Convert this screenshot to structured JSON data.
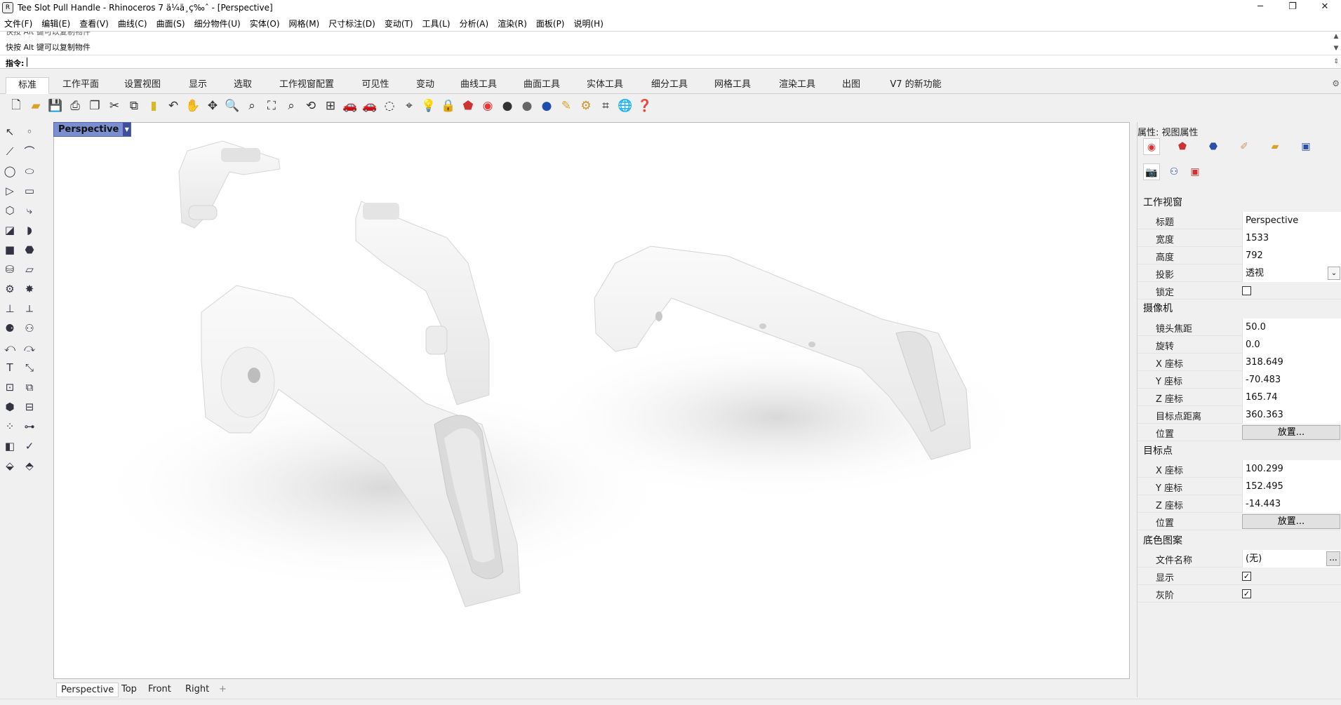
{
  "window": {
    "title": "Tee Slot Pull Handle - Rhinoceros 7 ä¼ä¸ç‰ˆ - [Perspective]",
    "minimize": "─",
    "maximize": "❐",
    "close": "✕"
  },
  "menu": [
    "文件(F)",
    "编辑(E)",
    "查看(V)",
    "曲线(C)",
    "曲面(S)",
    "细分物件(U)",
    "实体(O)",
    "网格(M)",
    "尺寸标注(D)",
    "变动(T)",
    "工具(L)",
    "分析(A)",
    "渲染(R)",
    "面板(P)",
    "说明(H)"
  ],
  "command": {
    "history1": "快按 Alt 键可以复制物件",
    "history2": "快按 Alt 键可以复制物件",
    "prompt": "指令:"
  },
  "tabs": [
    "标准",
    "工作平面",
    "设置视图",
    "显示",
    "选取",
    "工作视窗配置",
    "可见性",
    "变动",
    "曲线工具",
    "曲面工具",
    "实体工具",
    "细分工具",
    "网格工具",
    "渲染工具",
    "出图",
    "V7 的新功能"
  ],
  "active_tab": "标准",
  "viewport": {
    "title": "Perspective",
    "bottom_tabs": [
      "Perspective",
      "Top",
      "Front",
      "Right"
    ],
    "add_tab": "+"
  },
  "panel": {
    "title": "属性: 视图属性",
    "sections": {
      "viewport": "工作视窗",
      "camera": "摄像机",
      "target": "目标点",
      "wallpaper": "底色图案"
    },
    "viewport_rows": [
      {
        "label": "标题",
        "value": "Perspective"
      },
      {
        "label": "宽度",
        "value": "1533"
      },
      {
        "label": "高度",
        "value": "792"
      },
      {
        "label": "投影",
        "value": "透视"
      },
      {
        "label": "锁定",
        "value": ""
      }
    ],
    "camera_rows": [
      {
        "label": "镜头焦距",
        "value": "50.0"
      },
      {
        "label": "旋转",
        "value": "0.0"
      },
      {
        "label": "X 座标",
        "value": "318.649"
      },
      {
        "label": "Y 座标",
        "value": "-70.483"
      },
      {
        "label": "Z 座标",
        "value": "165.74"
      },
      {
        "label": "目标点距离",
        "value": "360.363"
      },
      {
        "label": "位置",
        "value": "放置..."
      }
    ],
    "target_rows": [
      {
        "label": "X 座标",
        "value": "100.299"
      },
      {
        "label": "Y 座标",
        "value": "152.495"
      },
      {
        "label": "Z 座标",
        "value": "-14.443"
      },
      {
        "label": "位置",
        "value": "放置..."
      }
    ],
    "wallpaper_rows": [
      {
        "label": "文件名称",
        "value": "(无)"
      },
      {
        "label": "显示",
        "value": "✓"
      },
      {
        "label": "灰阶",
        "value": "✓"
      }
    ],
    "browse": "..."
  }
}
